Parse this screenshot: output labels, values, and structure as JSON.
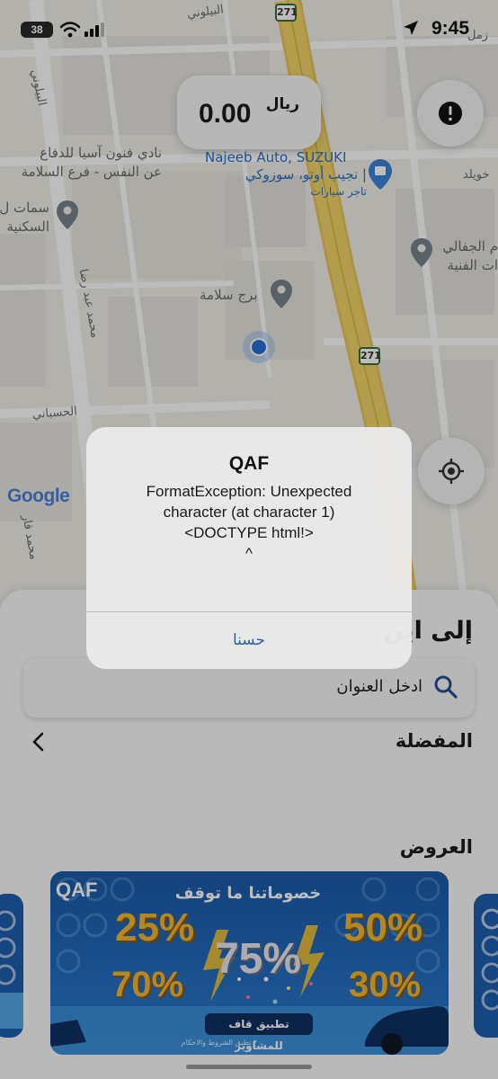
{
  "status_bar": {
    "time": "9:45",
    "battery": "38"
  },
  "map": {
    "labels": {
      "road_top": "البيلوني",
      "road_left_vertical": "البيلوني",
      "road_top_right": "زمل",
      "poi_club_line1": "نادي فنون آسيا للدفاع",
      "poi_club_line2": "عن النفس - فرع السلامة",
      "poi_samat_line1": "سمات ل",
      "poi_samat_line2": "السكنية",
      "poi_najeeb_line1": "Najeeb Auto, SUZUKI",
      "poi_najeeb_line2": "| نجيب أوتو، سوزوكي",
      "poi_najeeb_line3": "تاجر سيارات",
      "road_khwild": "خويلد",
      "poi_jefali_line1": "م الجفالي",
      "poi_jefali_line2": "ات الفنية",
      "poi_burj": "برج سلامة",
      "road_mohammed": "محمد عبد رضا",
      "road_hasbani": "الحسباني",
      "road_mohammed2": "محمد قار",
      "shield_top": "271",
      "shield_mid": "271",
      "google_logo": "Google"
    }
  },
  "fare": {
    "amount": "0.00",
    "currency": "ريال"
  },
  "sheet": {
    "title": "إلى اين",
    "address_placeholder": "ادخل العنوان",
    "favorites_title": "المفضلة",
    "offers_title": "العروض"
  },
  "banner": {
    "headline": "خصوماتنا ما توقف",
    "discounts": [
      "25%",
      "50%",
      "70%",
      "30%",
      "75%"
    ],
    "cta": "تطبيق قاف للمشاوير",
    "terms": "* تطبق الشروط والاحكام",
    "brand": "QAF"
  },
  "dialog": {
    "title": "QAF",
    "message": "FormatException: Unexpected\ncharacter (at character 1)\n<DOCTYPE html!>\n^",
    "button": "حسنا"
  },
  "colors": {
    "accent_blue": "#2f5fa5",
    "banner_blue": "#1d5fb0",
    "highway_yellow": "#f3d46a",
    "pin_grey": "#76838c"
  }
}
